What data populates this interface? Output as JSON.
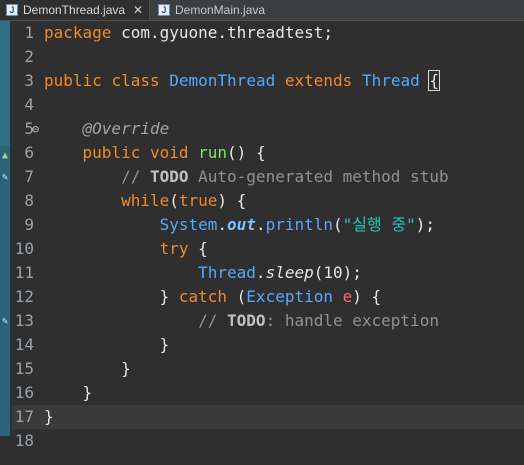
{
  "tabs": [
    {
      "label": "DemonThread.java",
      "active": true,
      "closable": true,
      "close_label": "✕"
    },
    {
      "label": "DemonMain.java",
      "active": false,
      "closable": false
    }
  ],
  "line_numbers": [
    "1",
    "2",
    "3",
    "4",
    "5",
    "6",
    "7",
    "8",
    "9",
    "10",
    "11",
    "12",
    "13",
    "14",
    "15",
    "16",
    "17",
    "18"
  ],
  "code": {
    "l1": {
      "kw": "package",
      "rest": " com.gyuone.threadtest;"
    },
    "l3": {
      "kw1": "public",
      "kw2": "class",
      "name": "DemonThread",
      "kw3": "extends",
      "super": "Thread",
      "brace": "{"
    },
    "l5": {
      "annotation": "@Override"
    },
    "l6": {
      "kw1": "public",
      "kw2": "void",
      "method": "run",
      "rest": "() {"
    },
    "l7": {
      "slashes": "// ",
      "todo": "TODO",
      "comment": " Auto-generated method stub"
    },
    "l8": {
      "kw": "while",
      "open": "(",
      "bool": "true",
      "close": ") {"
    },
    "l9": {
      "type": "System",
      "dot1": ".",
      "field": "out",
      "dot2": ".",
      "method": "println",
      "open": "(",
      "string": "\"실행 중\"",
      "close": ");"
    },
    "l10": {
      "kw": "try",
      "rest": " {"
    },
    "l11": {
      "type": "Thread",
      "dot": ".",
      "method": "sleep",
      "open": "(",
      "number": "10",
      "close": ");"
    },
    "l12": {
      "rbrace": "} ",
      "kw": "catch",
      "open": " (",
      "type": "Exception",
      "param": "e",
      "close": ") {"
    },
    "l13": {
      "slashes": "// ",
      "todo": "TODO",
      "comment": ": handle exception"
    },
    "l14": {
      "text": "}"
    },
    "l15": {
      "text": "}"
    },
    "l16": {
      "text": "}"
    },
    "l17": {
      "text": "}"
    }
  },
  "markers": {
    "fold": "⊖",
    "override": "▲",
    "task": "✎"
  },
  "colors": {
    "background": "#2f2f2f",
    "keyword": "#f08a2a",
    "type": "#57a7ff",
    "method": "#7ee36a",
    "string": "#25c7b6",
    "comment": "#8e9296",
    "ruler": "#2f6f86"
  }
}
